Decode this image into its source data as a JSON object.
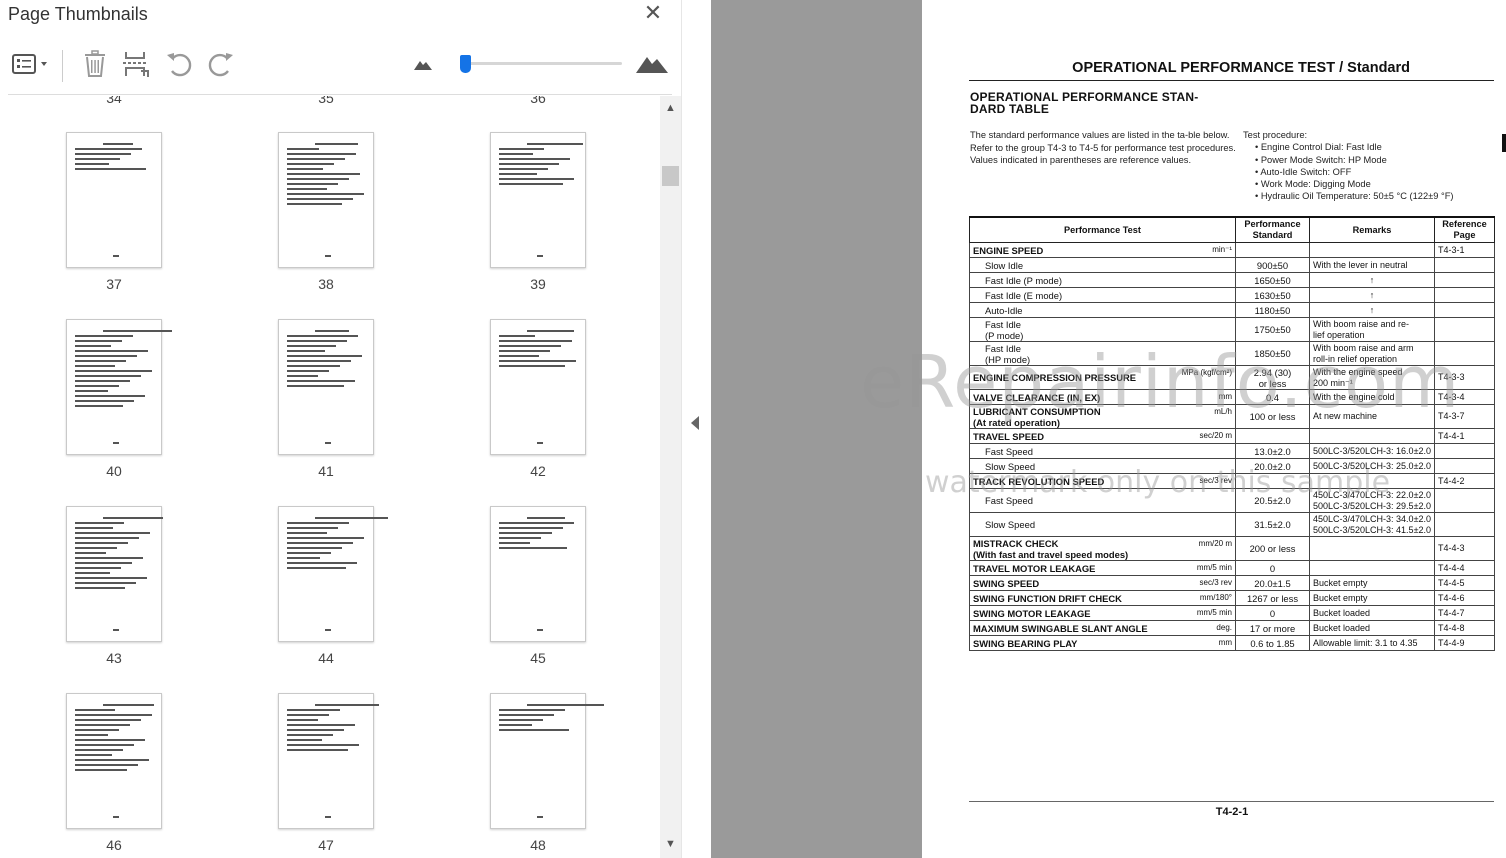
{
  "panel": {
    "title": "Page Thumbnails",
    "close_glyph": "✕",
    "toolbar": {
      "options_icon": "list-options-icon",
      "delete_icon": "trash-icon",
      "insert_icon": "insert-pages-icon",
      "rotate_ccw_icon": "rotate-left-icon",
      "rotate_cw_icon": "rotate-right-icon",
      "zoom_out_icon": "small-mountain-icon",
      "zoom_in_icon": "large-mountain-icon",
      "zoom_level": 0.02
    },
    "partial_labels": [
      "34",
      "35",
      "36"
    ],
    "thumbnails": [
      {
        "label": "37"
      },
      {
        "label": "38"
      },
      {
        "label": "39"
      },
      {
        "label": "40"
      },
      {
        "label": "41"
      },
      {
        "label": "42"
      },
      {
        "label": "43"
      },
      {
        "label": "44"
      },
      {
        "label": "45"
      },
      {
        "label": "46"
      },
      {
        "label": "47"
      },
      {
        "label": "48"
      }
    ]
  },
  "document": {
    "page_title": "OPERATIONAL PERFORMANCE TEST / Standard",
    "section_title_1": "OPERATIONAL  PERFORMANCE  STAN-",
    "section_title_2": "DARD TABLE",
    "intro": "The standard performance values are listed in the ta-ble below. Refer to the group T4-3 to T4-5 for performance test procedures. Values indicated in parentheses are reference values.",
    "test_procedure_title": "Test procedure:",
    "test_procedure": [
      "Engine Control Dial: Fast Idle",
      "Power Mode Switch: HP Mode",
      "Auto-Idle Switch: OFF",
      "Work Mode: Digging Mode",
      "Hydraulic Oil Temperature: 50±5 °C (122±9 °F)"
    ],
    "table_headers": {
      "test": "Performance Test",
      "std_1": "Performance",
      "std_2": "Standard",
      "remarks": "Remarks",
      "ref_1": "Reference",
      "ref_2": "Page"
    },
    "rows": [
      {
        "name": "ENGINE SPEED",
        "bold": true,
        "unit": "min⁻¹",
        "std": "",
        "rem": "",
        "ref": "T4-3-1"
      },
      {
        "name": "Slow Idle",
        "bold": false,
        "unit": "",
        "std": "900±50",
        "rem": "With the lever in neutral",
        "ref": ""
      },
      {
        "name": "Fast Idle (P mode)",
        "bold": false,
        "unit": "",
        "std": "1650±50",
        "rem": "↑",
        "ref": ""
      },
      {
        "name": "Fast Idle (E mode)",
        "bold": false,
        "unit": "",
        "std": "1630±50",
        "rem": "↑",
        "ref": ""
      },
      {
        "name": "Auto-Idle",
        "bold": false,
        "unit": "",
        "std": "1180±50",
        "rem": "↑",
        "ref": ""
      },
      {
        "name": "Fast Idle\n(P mode)",
        "bold": false,
        "unit": "",
        "std": "1750±50",
        "rem": "With boom raise and re-\nlief operation",
        "ref": ""
      },
      {
        "name": "Fast Idle\n(HP mode)",
        "bold": false,
        "unit": "",
        "std": "1850±50",
        "rem": "With boom raise and arm\nroll-in relief operation",
        "ref": ""
      },
      {
        "name": "ENGINE COMPRESSION PRESSURE",
        "bold": true,
        "unit": "MPa (kgf/cm²)",
        "std": "2.94 (30)\nor less",
        "rem": "With the engine speed\n200 min⁻¹",
        "ref": "T4-3-3"
      },
      {
        "name": "VALVE CLEARANCE (IN, EX)",
        "bold": true,
        "unit": "mm",
        "std": "0.4",
        "rem": "With the engine cold",
        "ref": "T4-3-4"
      },
      {
        "name": "LUBRICANT CONSUMPTION\n(At rated operation)",
        "bold": true,
        "unit": "mL/h",
        "std": "100 or less",
        "rem": "At new machine",
        "ref": "T4-3-7"
      },
      {
        "name": "TRAVEL SPEED",
        "bold": true,
        "unit": "sec/20 m",
        "std": "",
        "rem": "",
        "ref": "T4-4-1"
      },
      {
        "name": "Fast Speed",
        "bold": false,
        "unit": "",
        "std": "13.0±2.0",
        "rem": "500LC-3/520LCH-3: 16.0±2.0",
        "ref": ""
      },
      {
        "name": "Slow Speed",
        "bold": false,
        "unit": "",
        "std": "20.0±2.0",
        "rem": "500LC-3/520LCH-3: 25.0±2.0",
        "ref": ""
      },
      {
        "name": "TRACK REVOLUTION SPEED",
        "bold": true,
        "unit": "sec/3 rev",
        "std": "",
        "rem": "",
        "ref": "T4-4-2"
      },
      {
        "name": "Fast Speed",
        "bold": false,
        "unit": "",
        "std": "20.5±2.0",
        "rem": "450LC-3/470LCH-3: 22.0±2.0\n500LC-3/520LCH-3: 29.5±2.0",
        "ref": ""
      },
      {
        "name": "Slow Speed",
        "bold": false,
        "unit": "",
        "std": "31.5±2.0",
        "rem": "450LC-3/470LCH-3: 34.0±2.0\n500LC-3/520LCH-3: 41.5±2.0",
        "ref": ""
      },
      {
        "name": "MISTRACK CHECK\n(With fast and travel speed modes)",
        "bold": true,
        "unit": "mm/20 m",
        "std": "200 or less",
        "rem": "",
        "ref": "T4-4-3"
      },
      {
        "name": "TRAVEL MOTOR LEAKAGE",
        "bold": true,
        "unit": "mm/5 min",
        "std": "0",
        "rem": "",
        "ref": "T4-4-4"
      },
      {
        "name": "SWING SPEED",
        "bold": true,
        "unit": "sec/3 rev",
        "std": "20.0±1.5",
        "rem": "Bucket empty",
        "ref": "T4-4-5"
      },
      {
        "name": "SWING FUNCTION DRIFT CHECK",
        "bold": true,
        "unit": "mm/180°",
        "std": "1267 or less",
        "rem": "Bucket empty",
        "ref": "T4-4-6"
      },
      {
        "name": "SWING MOTOR LEAKAGE",
        "bold": true,
        "unit": "mm/5 min",
        "std": "0",
        "rem": "Bucket loaded",
        "ref": "T4-4-7"
      },
      {
        "name": "MAXIMUM SWINGABLE SLANT ANGLE",
        "bold": true,
        "unit": "deg.",
        "std": "17 or more",
        "rem": "Bucket loaded",
        "ref": "T4-4-8"
      },
      {
        "name": "SWING BEARING PLAY",
        "bold": true,
        "unit": "mm",
        "std": "0.6 to 1.85",
        "rem": "Allowable limit: 3.1 to 4.35",
        "ref": "T4-4-9"
      }
    ],
    "page_number": "T4-2-1",
    "watermark": "eRepairinfo.com",
    "watermark_sub": "watermark only on this sample"
  }
}
